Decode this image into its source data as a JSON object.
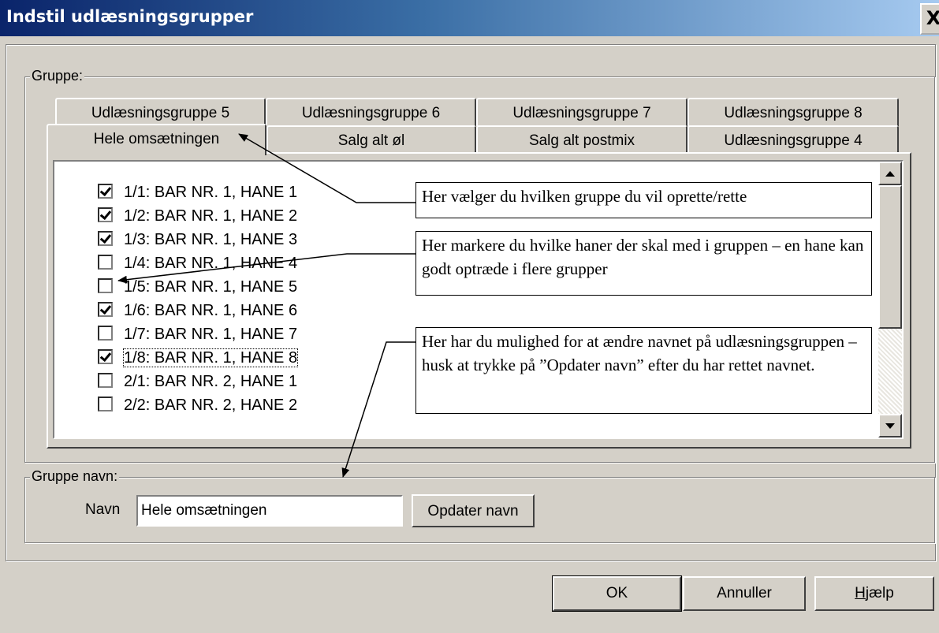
{
  "window": {
    "title": "Indstil udlæsningsgrupper",
    "close_label": "X"
  },
  "group_box": {
    "legend": "Gruppe:",
    "tabs_back_row": [
      "Udlæsningsgruppe 5",
      "Udlæsningsgruppe 6",
      "Udlæsningsgruppe 7",
      "Udlæsningsgruppe 8"
    ],
    "tabs_front_row": [
      "Hele omsætningen",
      "Salg alt øl",
      "Salg alt postmix",
      "Udlæsningsgruppe 4"
    ],
    "active_tab": "Hele omsætningen"
  },
  "tap_list": {
    "items": [
      {
        "label": "1/1: BAR NR. 1, HANE 1",
        "checked": true
      },
      {
        "label": "1/2: BAR NR. 1, HANE 2",
        "checked": true
      },
      {
        "label": "1/3: BAR NR. 1, HANE 3",
        "checked": true
      },
      {
        "label": "1/4: BAR NR. 1, HANE 4",
        "checked": false
      },
      {
        "label": "1/5: BAR NR. 1, HANE 5",
        "checked": false
      },
      {
        "label": "1/6: BAR NR. 1, HANE 6",
        "checked": true
      },
      {
        "label": "1/7: BAR NR. 1, HANE 7",
        "checked": false
      },
      {
        "label": "1/8: BAR NR. 1, HANE 8",
        "checked": true
      },
      {
        "label": "2/1: BAR NR. 2, HANE 1",
        "checked": false
      },
      {
        "label": "2/2: BAR NR. 2, HANE 2",
        "checked": false
      }
    ],
    "scroll_up_icon": "triangle-up-icon",
    "scroll_down_icon": "triangle-down-icon"
  },
  "callouts": {
    "choose_group": "Her vælger du hvilken gruppe du vil oprette/rette",
    "mark_taps": "Her markere du hvilke haner der skal med i gruppen – en hane kan godt optræde i flere grupper",
    "rename_group": "Her har du mulighed for at ændre navnet på udlæsningsgruppen – husk at trykke på ”Opdater navn” efter du har rettet navnet."
  },
  "name_box": {
    "legend": "Gruppe navn:",
    "label": "Navn",
    "value": "Hele omsætningen",
    "update_button": "Opdater navn"
  },
  "footer": {
    "ok": "OK",
    "cancel": "Annuller",
    "help_accel": "H",
    "help_rest": "jælp"
  }
}
